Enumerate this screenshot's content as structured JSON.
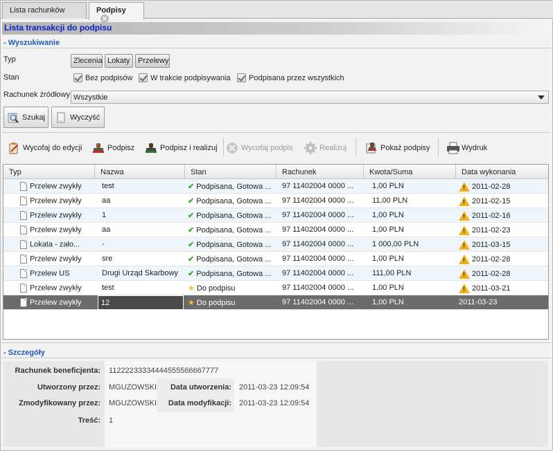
{
  "tabs": [
    {
      "label": "Lista rachunków"
    },
    {
      "label": "Podpisy"
    }
  ],
  "page_title": "Lista transakcji do podpisu",
  "search": {
    "section_title": "- Wyszukiwanie",
    "typ_label": "Typ",
    "typ_buttons": [
      "Zlecenia",
      "Lokaty",
      "Przelewy"
    ],
    "stan_label": "Stan",
    "stan_options": [
      "Bez podpisów",
      "W trakcie podpisywania",
      "Podpisana przez wszystkich"
    ],
    "account_label": "Rachunek źródłowy",
    "account_value": "Wszystkie",
    "search_button": "Szukaj",
    "clear_button": "Wyczyść"
  },
  "toolbar": {
    "withdraw_edit": "Wycofaj do edycji",
    "sign": "Podpisz",
    "sign_execute": "Podpisz i realizuj",
    "withdraw_sign": "Wycofaj podpis",
    "execute": "Realizuj",
    "show_signatures": "Pokaż podpisy",
    "print": "Wydruk"
  },
  "table": {
    "headers": [
      "Typ",
      "Nazwa",
      "Stan",
      "Rachunek",
      "Kwota/Suma",
      "Data wykonania"
    ],
    "rows": [
      [
        "Przelew zwykły",
        "test",
        "Podpisana, Gotowa ...",
        "97 11402004 0000 ...",
        "1,00 PLN",
        "2011-02-28"
      ],
      [
        "Przelew zwykły",
        "aa",
        "Podpisana, Gotowa ...",
        "97 11402004 0000 ...",
        "11,00 PLN",
        "2011-02-15"
      ],
      [
        "Przelew zwykły",
        "1",
        "Podpisana, Gotowa ...",
        "97 11402004 0000 ...",
        "1,00 PLN",
        "2011-02-16"
      ],
      [
        "Przelew zwykły",
        "aa",
        "Podpisana, Gotowa ...",
        "97 11402004 0000 ...",
        "1,00 PLN",
        "2011-02-23"
      ],
      [
        "Lokata - zało...",
        "-",
        "Podpisana, Gotowa ...",
        "97 11402004 0000 ...",
        "1 000,00 PLN",
        "2011-03-15"
      ],
      [
        "Przelew zwykły",
        "sre",
        "Podpisana, Gotowa ...",
        "97 11402004 0000 ...",
        "1,00 PLN",
        "2011-02-28"
      ],
      [
        "Przelew US",
        "Drugi Urząd Skarbowy",
        "Podpisana, Gotowa ...",
        "97 11402004 0000 ...",
        "111,00 PLN",
        "2011-02-28"
      ],
      [
        "Przelew zwykły",
        "test",
        "Do podpisu",
        "97 11402004 0000 ...",
        "1,00 PLN",
        "2011-03-21"
      ],
      [
        "Przelew zwykły",
        "12",
        "Do podpisu",
        "97 11402004 0000 ...",
        "1,00 PLN",
        "2011-03-23"
      ]
    ]
  },
  "details": {
    "section_title": "- Szczegóły",
    "beneficiary_label": "Rachunek beneficjenta:",
    "beneficiary_value": "11222233334444555566667777",
    "created_by_label": "Utworzony przez:",
    "created_by_value": "MGUZOWSKI",
    "created_date_label": "Data utworzenia:",
    "created_date_value": "2011-03-23 12:09:54",
    "modified_by_label": "Zmodyfikowany przez:",
    "modified_by_value": "MGUZOWSKI",
    "modified_date_label": "Data modyfikacji:",
    "modified_date_value": "2011-03-23 12:09:54",
    "content_label": "Treść:",
    "content_value": "1"
  }
}
